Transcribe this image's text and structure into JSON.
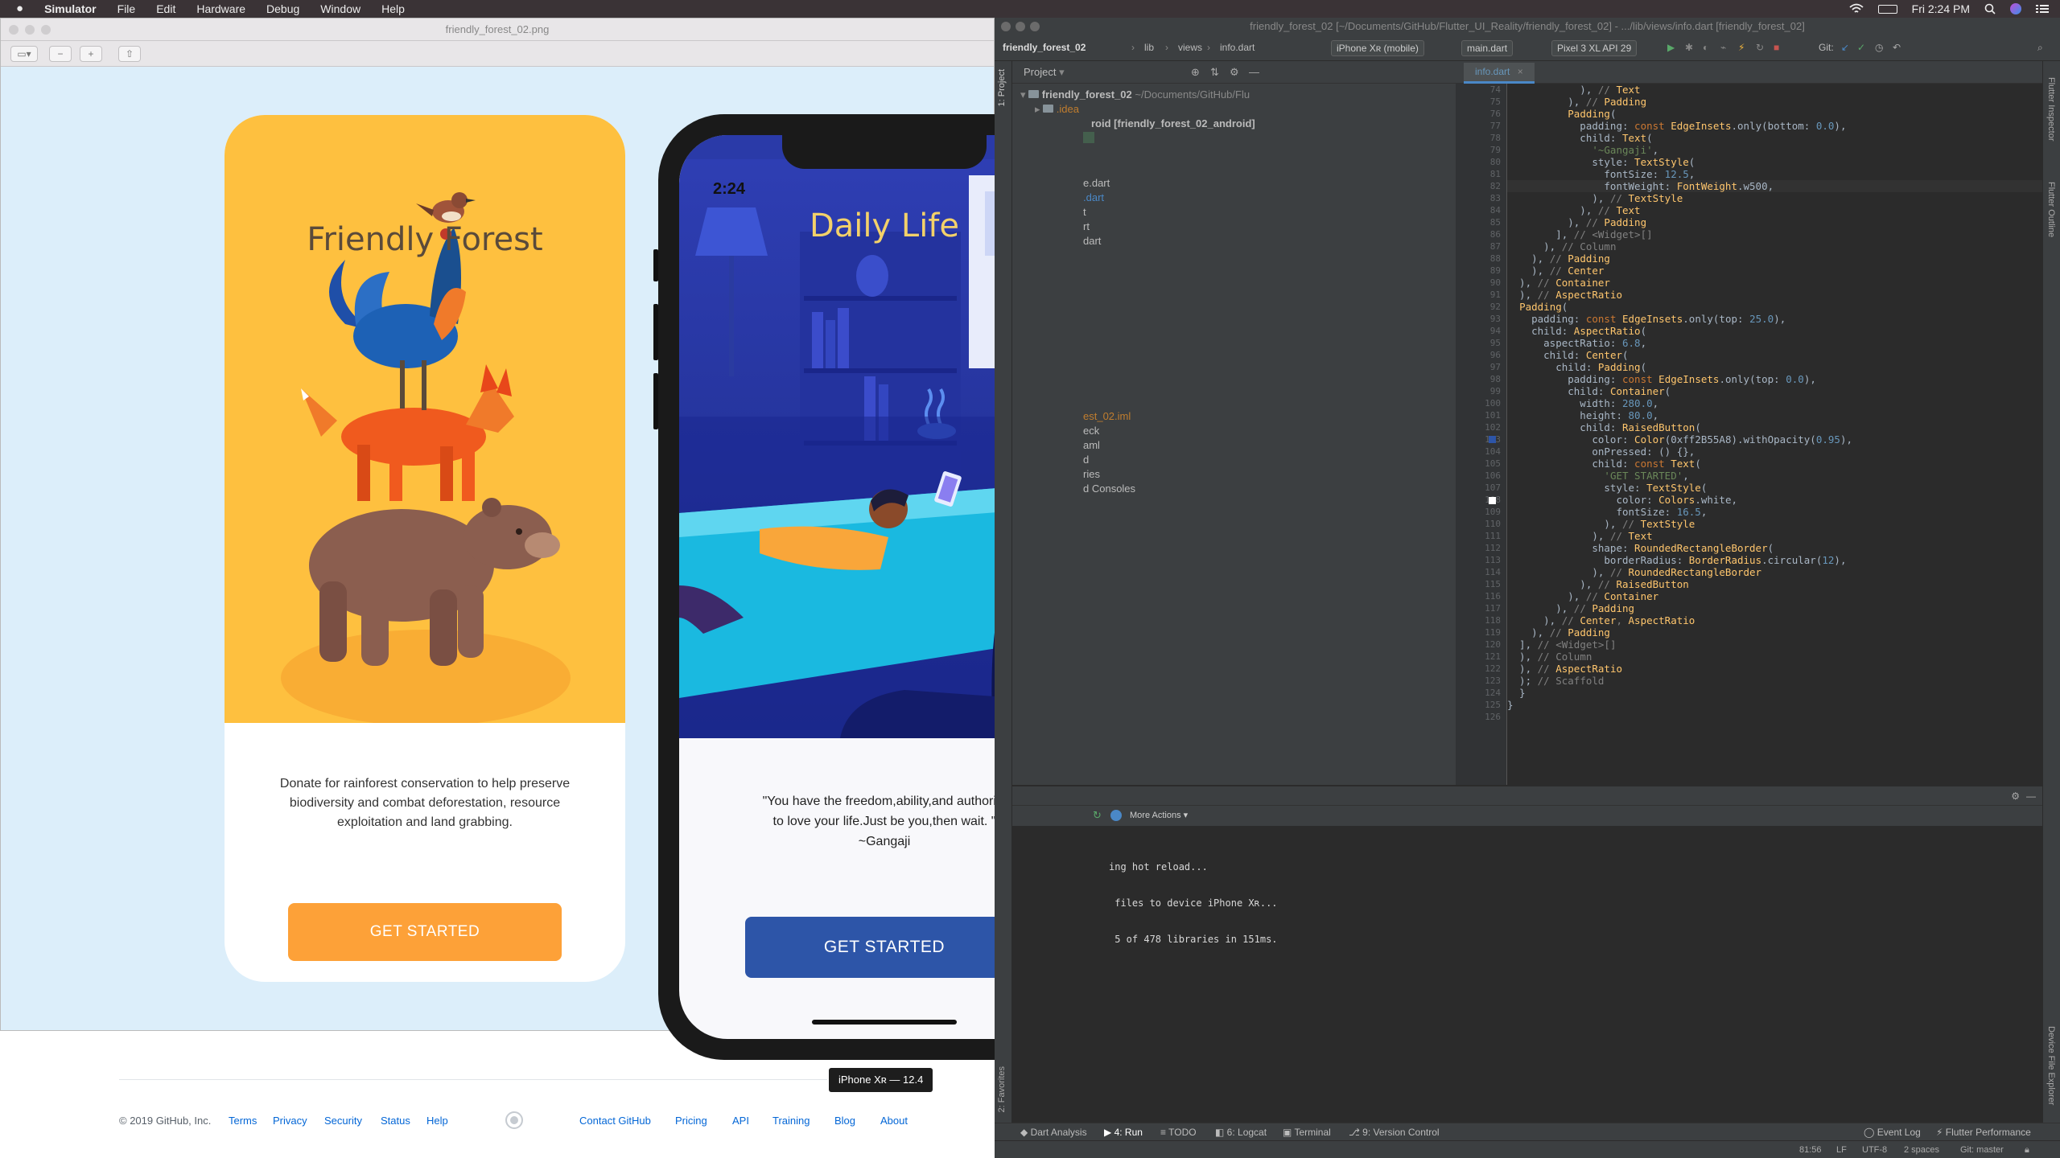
{
  "menubar": {
    "apple_icon": "apple-icon",
    "app": "Simulator",
    "items": [
      "File",
      "Edit",
      "Hardware",
      "Debug",
      "Window",
      "Help"
    ],
    "clock": "Fri 2:24 PM"
  },
  "simulator": {
    "window_title": "friendly_forest_02.png",
    "card1": {
      "title": "Friendly Forest",
      "description": "Donate for rainforest conservation to help preserve biodiversity and combat deforestation, resource exploitation and land grabbing.",
      "button": "GET STARTED",
      "colors": {
        "top": "#fec03f",
        "button": "#fda138"
      }
    },
    "phone": {
      "time": "2:24",
      "title": "Daily Life",
      "quote_line1": "\"You have the freedom,ability,and authority",
      "quote_line2": "to love your life.Just be you,then wait. \"",
      "quote_author": "~Gangaji",
      "button": "GET STARTED",
      "colors": {
        "button": "#2d55a8",
        "title": "#f3d16a"
      }
    },
    "device_tooltip": "iPhone Xʀ — 12.4"
  },
  "github_footer": {
    "copyright": "© 2019 GitHub, Inc.",
    "links_left": [
      "Terms",
      "Privacy",
      "Security",
      "Status",
      "Help"
    ],
    "links_right": [
      "Contact GitHub",
      "Pricing",
      "API",
      "Training",
      "Blog",
      "About"
    ]
  },
  "ide": {
    "window_title": "friendly_forest_02 [~/Documents/GitHub/Flutter_UI_Reality/friendly_forest_02] - .../lib/views/info.dart [friendly_forest_02]",
    "breadcrumbs": [
      "friendly_forest_02",
      "lib",
      "views",
      "info.dart"
    ],
    "device_selector": "iPhone Xʀ (mobile)",
    "run_config": "main.dart",
    "emulator": "Pixel 3 XL API 29",
    "git_label": "Git:",
    "project_label": "Project",
    "project_root": "friendly_forest_02",
    "project_root_path": "~/Documents/GitHub/Flu",
    "idea_folder": ".idea",
    "android_module": "roid [friendly_forest_02_android]",
    "tree_fragments": [
      "e.dart",
      ".dart",
      "t",
      "rt",
      "dart",
      "est_02.iml",
      "eck",
      "aml",
      "d",
      "ries",
      "d Consoles"
    ],
    "editor_tab": "info.dart",
    "sidebar_left": [
      "1: Project",
      "2: Favorites"
    ],
    "sidebar_right": [
      "Flutter Inspector",
      "Flutter Outline",
      "Device File Explorer"
    ],
    "first_line_number": 74,
    "code_lines": [
      "            ), // Text",
      "          ), // Padding",
      "          Padding(",
      "            padding: const EdgeInsets.only(bottom: 0.0),",
      "            child: Text(",
      "              '~Gangaji',",
      "              style: TextStyle(",
      "                fontSize: 12.5,",
      "                fontWeight: FontWeight.w500,",
      "              ), // TextStyle",
      "            ), // Text",
      "          ), // Padding",
      "        ], // <Widget>[]",
      "      ), // Column",
      "    ), // Padding",
      "    ), // Center",
      "  ), // Container",
      "  ), // AspectRatio",
      "  Padding(",
      "    padding: const EdgeInsets.only(top: 25.0),",
      "    child: AspectRatio(",
      "      aspectRatio: 6.8,",
      "      child: Center(",
      "        child: Padding(",
      "          padding: const EdgeInsets.only(top: 0.0),",
      "          child: Container(",
      "            width: 280.0,",
      "            height: 80.0,",
      "            child: RaisedButton(",
      "              color: Color(0xff2B55A8).withOpacity(0.95),",
      "              onPressed: () {},",
      "              child: const Text(",
      "                'GET STARTED',",
      "                style: TextStyle(",
      "                  color: Colors.white,",
      "                  fontSize: 16.5,",
      "                ), // TextStyle",
      "              ), // Text",
      "              shape: RoundedRectangleBorder(",
      "                borderRadius: BorderRadius.circular(12),",
      "              ), // RoundedRectangleBorder",
      "            ), // RaisedButton",
      "          ), // Container",
      "        ), // Padding",
      "      ), // Center, AspectRatio",
      "    ), // Padding",
      "  ], // <Widget>[]",
      "  ), // Column",
      "  ), // AspectRatio",
      "  ); // Scaffold",
      "  }",
      "}",
      ""
    ],
    "run_panel": {
      "more_actions": "More Actions",
      "log_lines": [
        "ing hot reload...",
        " files to device iPhone Xʀ...",
        " 5 of 478 libraries in 151ms."
      ]
    },
    "bottom_tabs": [
      "Dart Analysis",
      "4: Run",
      "TODO",
      "6: Logcat",
      "Terminal",
      "9: Version Control"
    ],
    "bottom_right": [
      "Event Log",
      "Flutter Performance"
    ],
    "status": {
      "position": "81:56",
      "line_sep": "LF",
      "encoding": "UTF-8",
      "indent": "2 spaces",
      "git": "Git: master"
    }
  }
}
